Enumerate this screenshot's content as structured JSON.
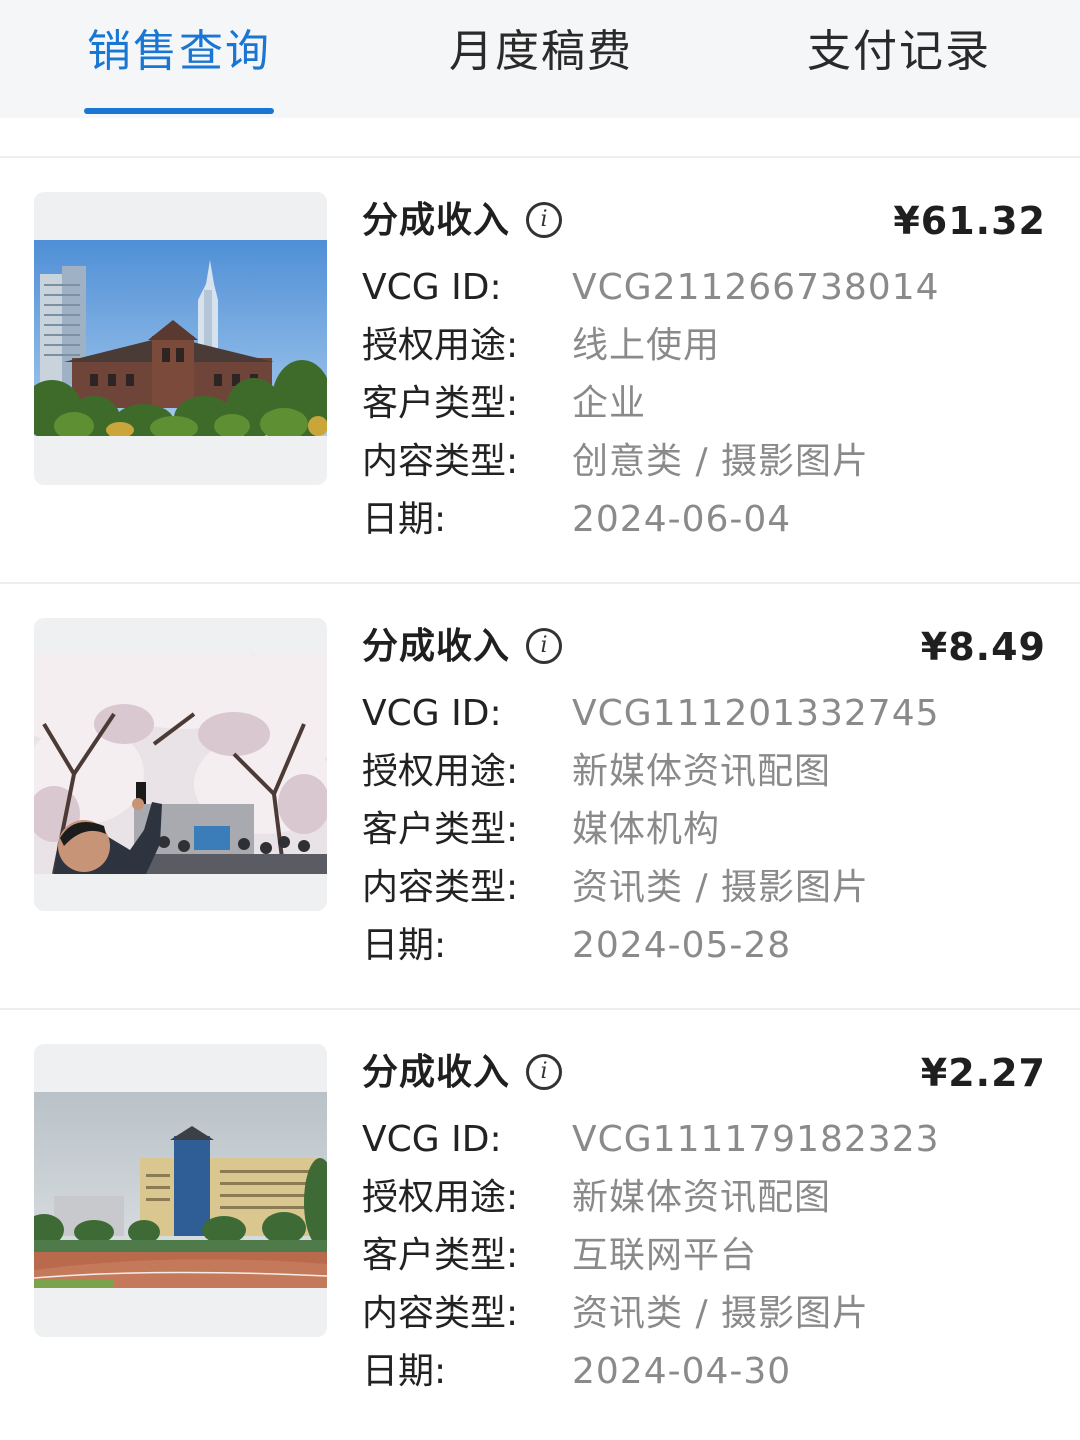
{
  "tabs": [
    {
      "label": "销售查询",
      "active": true
    },
    {
      "label": "月度稿费",
      "active": false
    },
    {
      "label": "支付记录",
      "active": false
    }
  ],
  "colors": {
    "accent": "#1976d2",
    "value_text": "#8a8a8a",
    "divider": "#eceef1"
  },
  "labels": {
    "income": "分成收入",
    "info_icon": "i",
    "vcg_id": "VCG ID:",
    "usage": "授权用途:",
    "customer_type": "客户类型:",
    "content_type": "内容类型:",
    "date": "日期:"
  },
  "records": [
    {
      "amount": "¥61.32",
      "vcg_id": "VCG211266738014",
      "usage": "线上使用",
      "customer_type": "企业",
      "content_type": "创意类 / 摄影图片",
      "date": "2024-06-04",
      "thumbnail": "building-with-skyscraper-photo"
    },
    {
      "amount": "¥8.49",
      "vcg_id": "VCG111201332745",
      "usage": "新媒体资讯配图",
      "customer_type": "媒体机构",
      "content_type": "资讯类 / 摄影图片",
      "date": "2024-05-28",
      "thumbnail": "cherry-blossom-photo"
    },
    {
      "amount": "¥2.27",
      "vcg_id": "VCG111179182323",
      "usage": "新媒体资讯配图",
      "customer_type": "互联网平台",
      "content_type": "资讯类 / 摄影图片",
      "date": "2024-04-30",
      "thumbnail": "campus-building-track-photo"
    }
  ]
}
